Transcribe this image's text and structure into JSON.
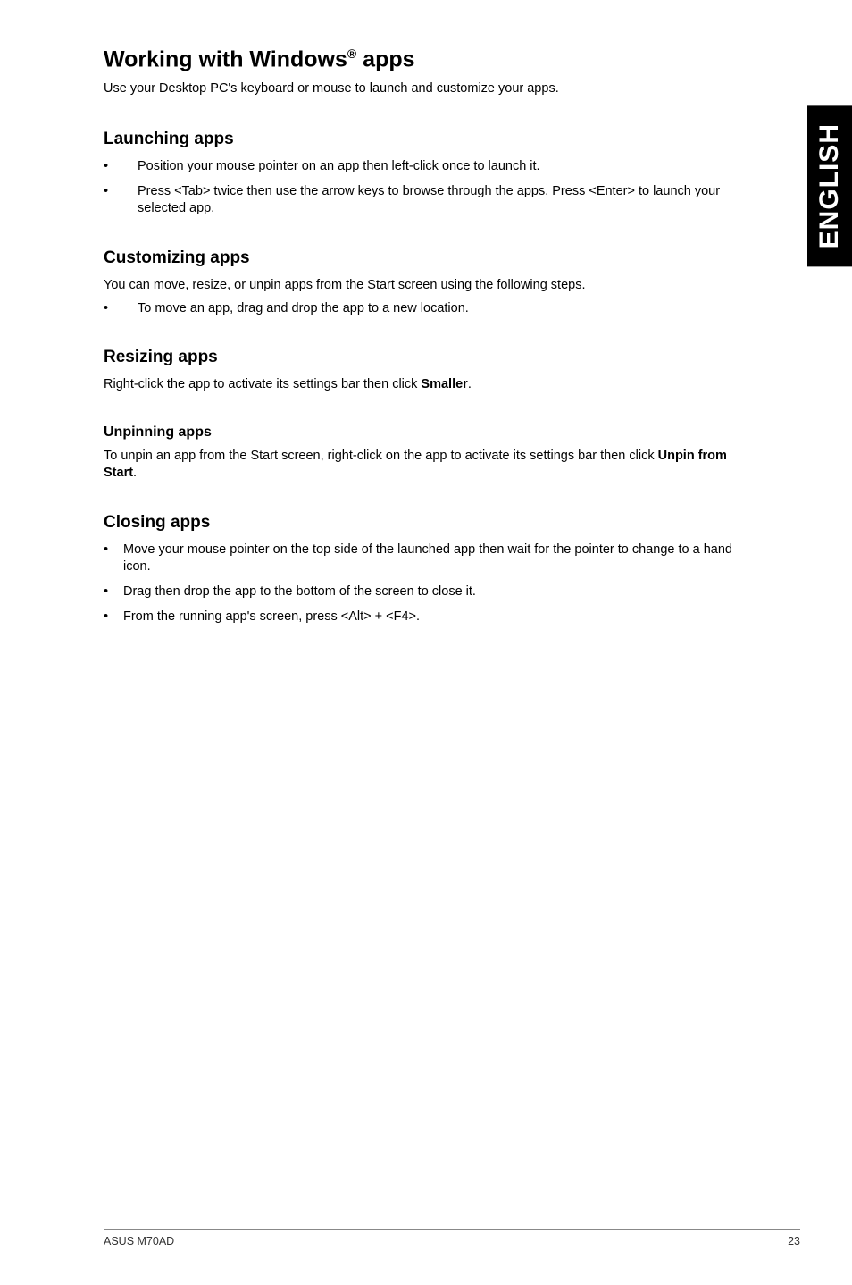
{
  "side_tab": "ENGLISH",
  "title_pre": "Working with Windows",
  "title_sup": "®",
  "title_post": " apps",
  "intro": "Use your Desktop PC's keyboard or mouse to launch and customize your apps.",
  "launching": {
    "heading": "Launching apps",
    "items": [
      "Position your mouse pointer on an app then left-click once to launch it.",
      "Press <Tab> twice then use the arrow keys to browse through the apps. Press <Enter> to launch your selected app."
    ]
  },
  "customizing": {
    "heading": "Customizing apps",
    "body": "You can move, resize, or unpin apps from the Start screen using the following steps.",
    "items": [
      "To move an app, drag and drop the app to a new location."
    ]
  },
  "resizing": {
    "heading": "Resizing apps",
    "body_pre": "Right-click the app to activate its settings bar then click ",
    "body_bold": "Smaller",
    "body_post": "."
  },
  "unpinning": {
    "heading": "Unpinning apps",
    "body_pre": "To unpin an app from the Start screen, right-click on the app to activate its settings bar then click ",
    "body_bold": "Unpin from Start",
    "body_post": "."
  },
  "closing": {
    "heading": "Closing apps",
    "items": [
      "Move your mouse pointer on the top side of the launched app then wait for the pointer to change to a hand icon.",
      "Drag then drop the app to the bottom of the screen to close it.",
      "From the running app's screen, press <Alt> + <F4>."
    ]
  },
  "footer": {
    "left": "ASUS M70AD",
    "right": "23"
  }
}
